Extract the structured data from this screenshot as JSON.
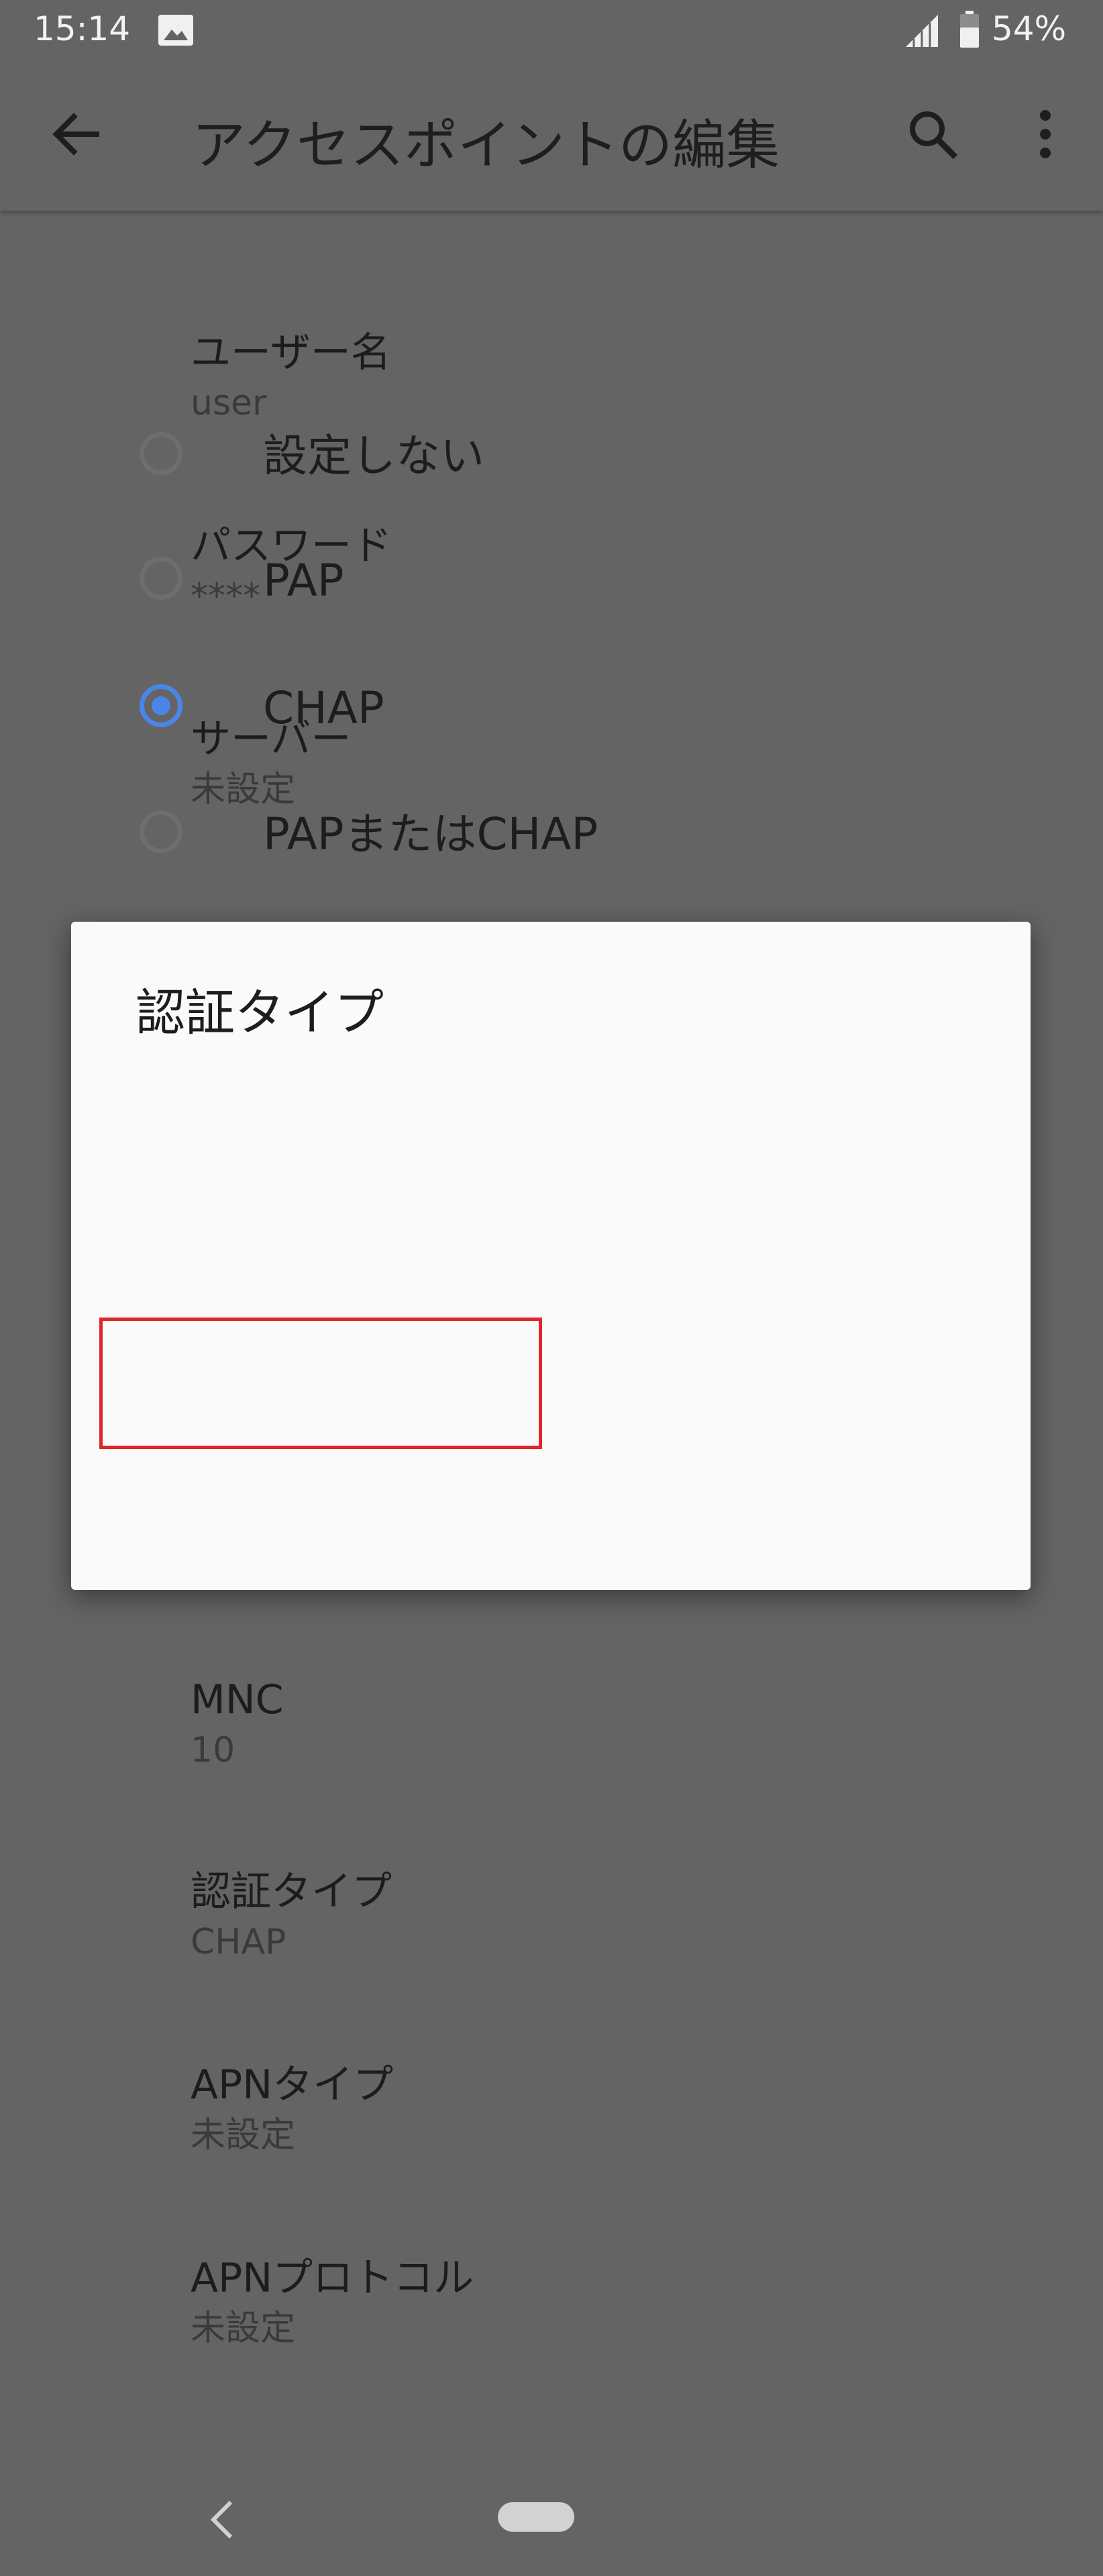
{
  "status_bar": {
    "time": "15:14",
    "battery": "54%",
    "icons": [
      "image-notification-icon",
      "signal-icon",
      "battery-icon"
    ]
  },
  "app_bar": {
    "title": "アクセスポイントの編集",
    "icons": [
      "back-arrow-icon",
      "search-icon",
      "more-vert-icon"
    ]
  },
  "settings": [
    {
      "title": "",
      "value": "未設定"
    },
    {
      "title": "ユーザー名",
      "value": "user"
    },
    {
      "title": "パスワード",
      "value": "****"
    },
    {
      "title": "サーバー",
      "value": "未設定"
    },
    {
      "title": "MNC",
      "value": "10"
    },
    {
      "title": "認証タイプ",
      "value": "CHAP"
    },
    {
      "title": "APNタイプ",
      "value": "未設定"
    },
    {
      "title": "APNプロトコル",
      "value": "未設定"
    }
  ],
  "dialog": {
    "title": "認証タイプ",
    "selected_index": 2,
    "options": [
      {
        "label": "設定しない"
      },
      {
        "label": "PAP"
      },
      {
        "label": "CHAP"
      },
      {
        "label": "PAPまたはCHAP"
      }
    ]
  },
  "colors": {
    "scrim_background": "#646464",
    "dialog_background": "#fafafa",
    "radio_selected": "#4a86e8",
    "radio_unselected": "#6e6e6e",
    "highlight_box": "#e0262b"
  },
  "nav_bar": {
    "icons": [
      "nav-back-icon",
      "home-pill-icon"
    ]
  }
}
